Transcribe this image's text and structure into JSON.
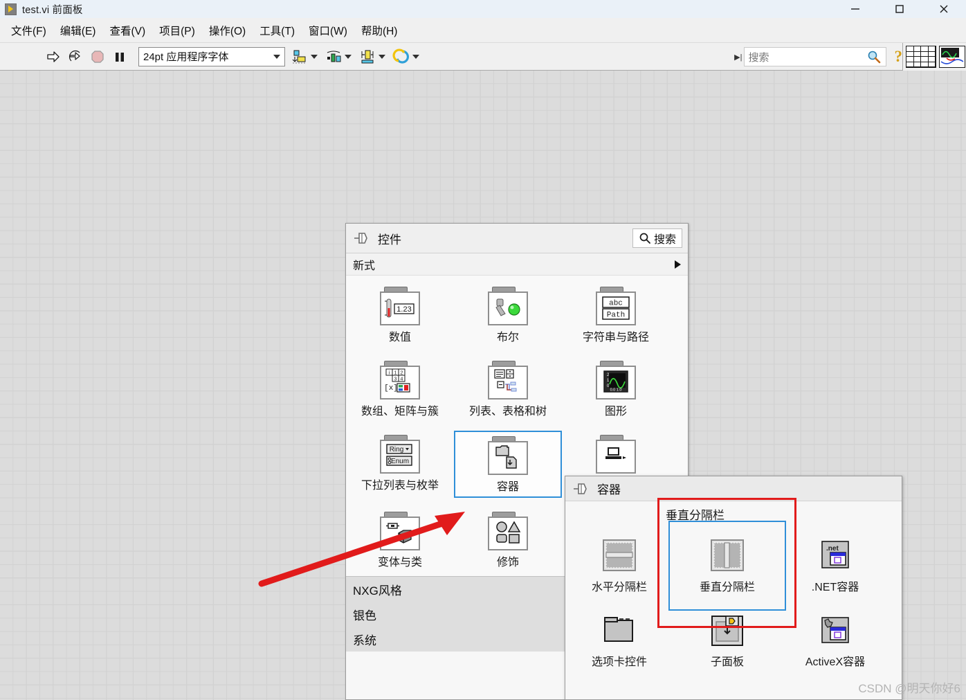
{
  "window": {
    "title": "test.vi 前面板",
    "icon": "labview-run-icon",
    "controls": {
      "minimize": "minimize-icon",
      "maximize": "maximize-icon",
      "close": "close-icon"
    }
  },
  "menubar": {
    "items": [
      {
        "label": "文件(F)",
        "name": "menu-file"
      },
      {
        "label": "编辑(E)",
        "name": "menu-edit"
      },
      {
        "label": "查看(V)",
        "name": "menu-view"
      },
      {
        "label": "项目(P)",
        "name": "menu-project"
      },
      {
        "label": "操作(O)",
        "name": "menu-operate"
      },
      {
        "label": "工具(T)",
        "name": "menu-tools"
      },
      {
        "label": "窗口(W)",
        "name": "menu-window"
      },
      {
        "label": "帮助(H)",
        "name": "menu-help"
      }
    ]
  },
  "toolbar": {
    "run": "run-arrow-icon",
    "run_continuously": "run-continuously-icon",
    "abort": "abort-execution-icon",
    "pause": "pause-icon",
    "font_selector": "24pt 应用程序字体",
    "align_objects": "align-objects-icon",
    "distribute_objects": "distribute-objects-icon",
    "resize_objects": "resize-objects-icon",
    "reorder": "reorder-icon",
    "search_placeholder": "搜索",
    "search_value": "",
    "search_icon": "magnifier-icon",
    "help_icon": "help-question-icon",
    "connector_pane": "connector-pane-grid",
    "vi_icon": "vi-icon"
  },
  "palette": {
    "header_title": "控件",
    "pin_icon": "pin-icon",
    "search_button": "搜索",
    "search_icon": "magnifier-icon",
    "category_row": "新式",
    "category_arrow": "arrow-right-icon",
    "items": [
      {
        "label": "数值",
        "icon": "numeric-folder-icon",
        "selected": false
      },
      {
        "label": "布尔",
        "icon": "boolean-folder-icon",
        "selected": false
      },
      {
        "label": "字符串与路径",
        "icon": "string-path-folder-icon",
        "selected": false
      },
      {
        "label": "数组、矩阵与簇",
        "icon": "array-matrix-cluster-folder-icon",
        "selected": false
      },
      {
        "label": "列表、表格和树",
        "icon": "list-table-tree-folder-icon",
        "selected": false
      },
      {
        "label": "图形",
        "icon": "graph-folder-icon",
        "selected": false
      },
      {
        "label": "下拉列表与枚举",
        "icon": "ring-enum-folder-icon",
        "selected": false
      },
      {
        "label": "容器",
        "icon": "containers-folder-icon",
        "selected": true
      },
      {
        "label": "",
        "icon": "io-folder-icon",
        "selected": false
      },
      {
        "label": "变体与类",
        "icon": "variant-class-folder-icon",
        "selected": false
      },
      {
        "label": "修饰",
        "icon": "decorations-folder-icon",
        "selected": false
      }
    ],
    "categories": [
      {
        "label": "NXG风格"
      },
      {
        "label": "银色"
      },
      {
        "label": "系统"
      }
    ]
  },
  "subpalette": {
    "header_title": "容器",
    "pin_icon": "pin-icon",
    "tooltip": "垂直分隔栏",
    "items": [
      {
        "label": "水平分隔栏",
        "icon": "horizontal-splitter-icon",
        "selected": false
      },
      {
        "label": "垂直分隔栏",
        "icon": "vertical-splitter-icon",
        "selected": true
      },
      {
        "label": ".NET容器",
        "icon": "dotnet-container-icon",
        "selected": false
      },
      {
        "label": "选项卡控件",
        "icon": "tab-control-icon",
        "selected": false
      },
      {
        "label": "子面板",
        "icon": "subpanel-icon",
        "selected": false
      },
      {
        "label": "ActiveX容器",
        "icon": "activex-container-icon",
        "selected": false
      }
    ]
  },
  "annotations": {
    "arrow": "red-pointer-arrow",
    "highlight_box": "red-highlight-box",
    "selection_box": "blue-selection-box",
    "accent_red": "#e11b1b",
    "accent_blue": "#2f8fd8"
  },
  "watermark": "CSDN @明天你好6"
}
